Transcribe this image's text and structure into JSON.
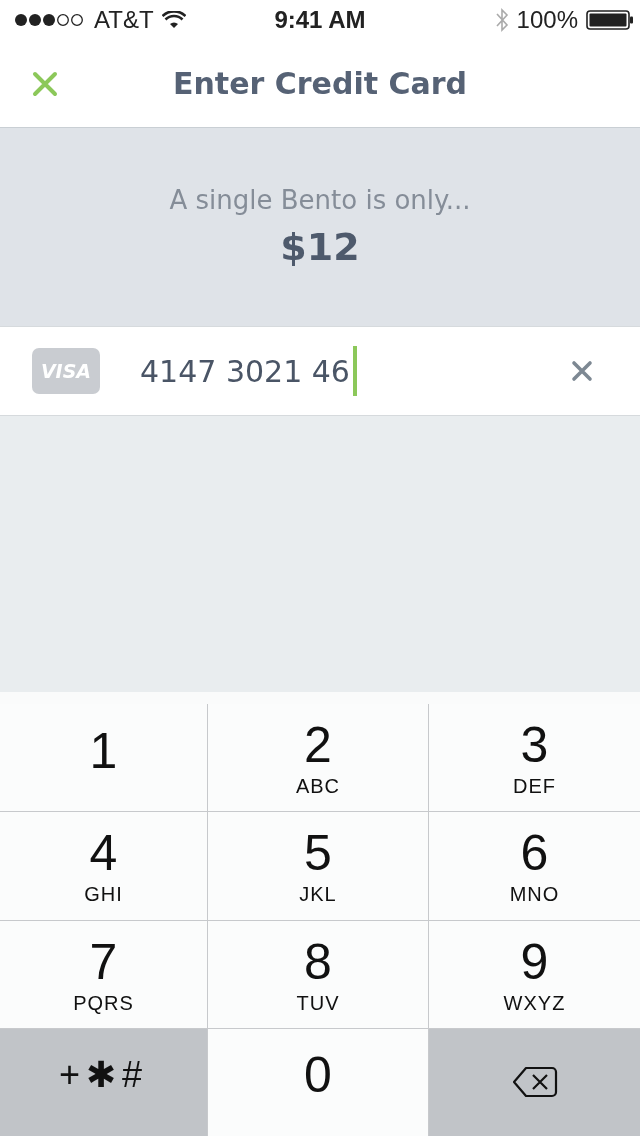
{
  "status_bar": {
    "carrier": "AT&T",
    "time": "9:41 AM",
    "battery": "100%"
  },
  "nav": {
    "title": "Enter Credit Card"
  },
  "promo": {
    "caption": "A single Bento is only...",
    "price": "$12"
  },
  "card_field": {
    "brand": "VISA",
    "value": "4147 3021 46"
  },
  "keypad": [
    {
      "kind": "digit",
      "digit": "1"
    },
    {
      "kind": "digit",
      "digit": "2",
      "letters": "ABC"
    },
    {
      "kind": "digit",
      "digit": "3",
      "letters": "DEF"
    },
    {
      "kind": "digit",
      "digit": "4",
      "letters": "GHI"
    },
    {
      "kind": "digit",
      "digit": "5",
      "letters": "JKL"
    },
    {
      "kind": "digit",
      "digit": "6",
      "letters": "MNO"
    },
    {
      "kind": "digit",
      "digit": "7",
      "letters": "PQRS"
    },
    {
      "kind": "digit",
      "digit": "8",
      "letters": "TUV"
    },
    {
      "kind": "digit",
      "digit": "9",
      "letters": "WXYZ"
    },
    {
      "kind": "symbols",
      "label": "+✱#"
    },
    {
      "kind": "digit",
      "digit": "0"
    },
    {
      "kind": "delete"
    }
  ]
}
